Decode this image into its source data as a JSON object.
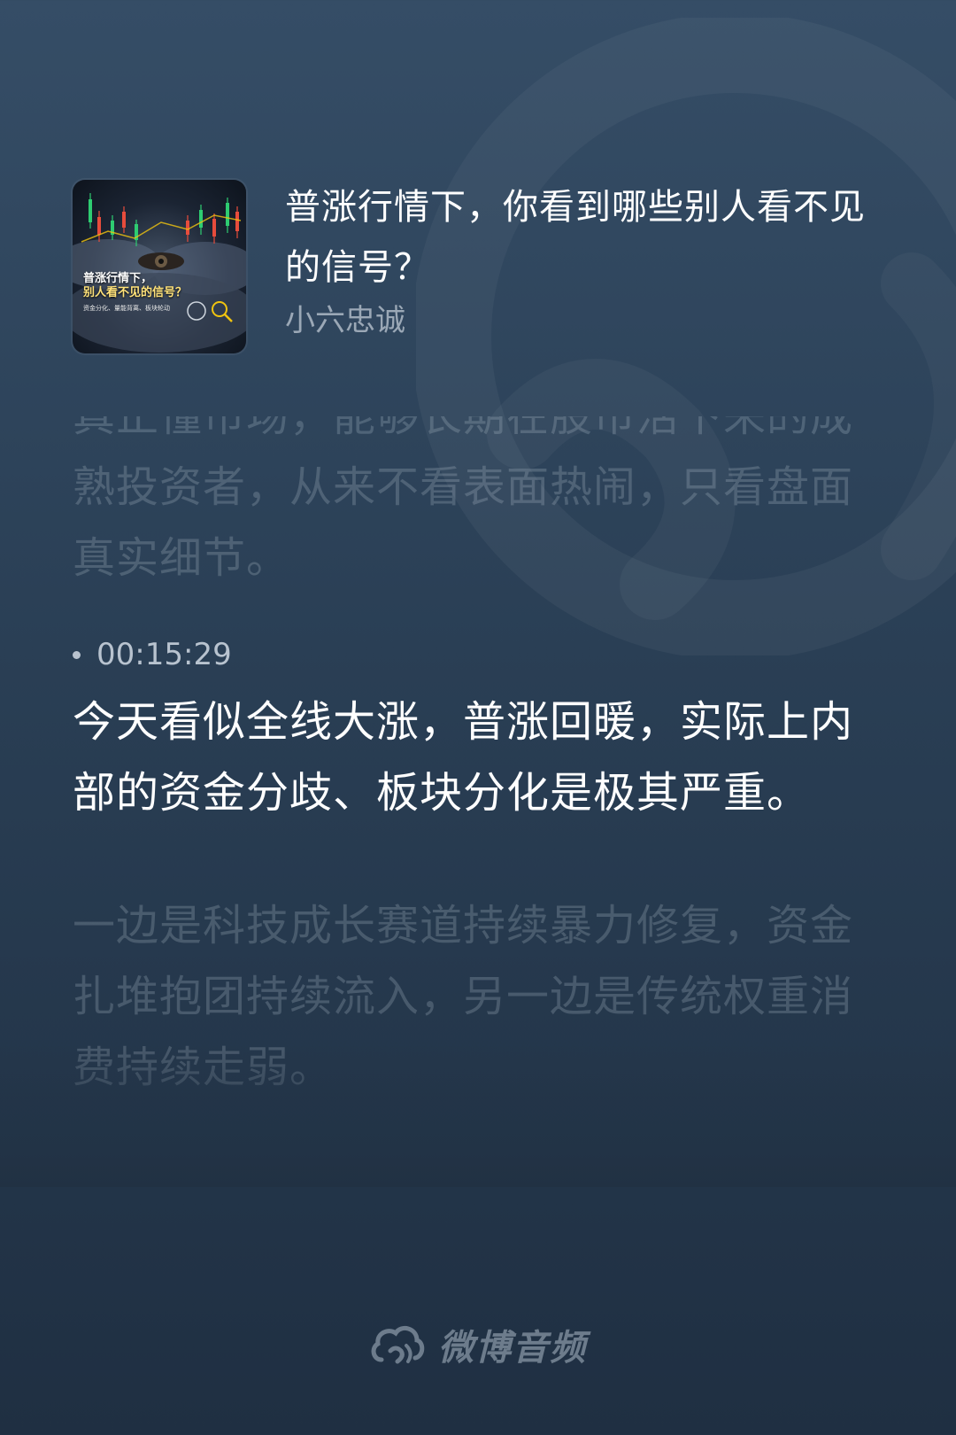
{
  "episode": {
    "title": "普涨行情下，你看到哪些别人看不见的信号？",
    "author": "小六忠诚",
    "cover": {
      "title_line1": "普涨行情下，",
      "title_line2": "别人看不见的信号？",
      "subtitle": "资金分化、量能背离、板块轮动"
    }
  },
  "lyrics": {
    "previous": "真正懂市场，能够长期在股市活下来的成熟投资者，从来不看表面热闹，只看盘面真实细节。",
    "current_timestamp": "00:15:29",
    "current": "今天看似全线大涨，普涨回暖，实际上内部的资金分歧、板块分化是极其严重。",
    "next": "一边是科技成长赛道持续暴力修复，资金扎堆抱团持续流入，另一边是传统权重消费持续走弱。"
  },
  "brand": {
    "name": "微博音频",
    "icon": "weibo-audio-logo-icon"
  },
  "colors": {
    "background_top": "#354d66",
    "background_bottom": "#1f2f42",
    "current_text": "#ffffff",
    "secondary_text": "#9ba8b6"
  }
}
